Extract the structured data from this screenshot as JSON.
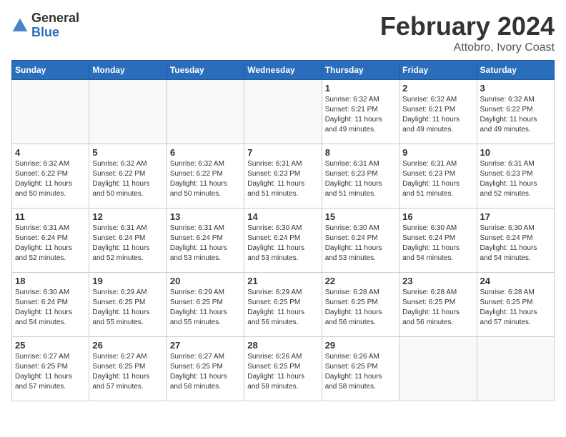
{
  "header": {
    "logo_general": "General",
    "logo_blue": "Blue",
    "month": "February 2024",
    "location": "Attobro, Ivory Coast"
  },
  "weekdays": [
    "Sunday",
    "Monday",
    "Tuesday",
    "Wednesday",
    "Thursday",
    "Friday",
    "Saturday"
  ],
  "weeks": [
    [
      {
        "day": "",
        "detail": ""
      },
      {
        "day": "",
        "detail": ""
      },
      {
        "day": "",
        "detail": ""
      },
      {
        "day": "",
        "detail": ""
      },
      {
        "day": "1",
        "detail": "Sunrise: 6:32 AM\nSunset: 6:21 PM\nDaylight: 11 hours\nand 49 minutes."
      },
      {
        "day": "2",
        "detail": "Sunrise: 6:32 AM\nSunset: 6:21 PM\nDaylight: 11 hours\nand 49 minutes."
      },
      {
        "day": "3",
        "detail": "Sunrise: 6:32 AM\nSunset: 6:22 PM\nDaylight: 11 hours\nand 49 minutes."
      }
    ],
    [
      {
        "day": "4",
        "detail": "Sunrise: 6:32 AM\nSunset: 6:22 PM\nDaylight: 11 hours\nand 50 minutes."
      },
      {
        "day": "5",
        "detail": "Sunrise: 6:32 AM\nSunset: 6:22 PM\nDaylight: 11 hours\nand 50 minutes."
      },
      {
        "day": "6",
        "detail": "Sunrise: 6:32 AM\nSunset: 6:22 PM\nDaylight: 11 hours\nand 50 minutes."
      },
      {
        "day": "7",
        "detail": "Sunrise: 6:31 AM\nSunset: 6:23 PM\nDaylight: 11 hours\nand 51 minutes."
      },
      {
        "day": "8",
        "detail": "Sunrise: 6:31 AM\nSunset: 6:23 PM\nDaylight: 11 hours\nand 51 minutes."
      },
      {
        "day": "9",
        "detail": "Sunrise: 6:31 AM\nSunset: 6:23 PM\nDaylight: 11 hours\nand 51 minutes."
      },
      {
        "day": "10",
        "detail": "Sunrise: 6:31 AM\nSunset: 6:23 PM\nDaylight: 11 hours\nand 52 minutes."
      }
    ],
    [
      {
        "day": "11",
        "detail": "Sunrise: 6:31 AM\nSunset: 6:24 PM\nDaylight: 11 hours\nand 52 minutes."
      },
      {
        "day": "12",
        "detail": "Sunrise: 6:31 AM\nSunset: 6:24 PM\nDaylight: 11 hours\nand 52 minutes."
      },
      {
        "day": "13",
        "detail": "Sunrise: 6:31 AM\nSunset: 6:24 PM\nDaylight: 11 hours\nand 53 minutes."
      },
      {
        "day": "14",
        "detail": "Sunrise: 6:30 AM\nSunset: 6:24 PM\nDaylight: 11 hours\nand 53 minutes."
      },
      {
        "day": "15",
        "detail": "Sunrise: 6:30 AM\nSunset: 6:24 PM\nDaylight: 11 hours\nand 53 minutes."
      },
      {
        "day": "16",
        "detail": "Sunrise: 6:30 AM\nSunset: 6:24 PM\nDaylight: 11 hours\nand 54 minutes."
      },
      {
        "day": "17",
        "detail": "Sunrise: 6:30 AM\nSunset: 6:24 PM\nDaylight: 11 hours\nand 54 minutes."
      }
    ],
    [
      {
        "day": "18",
        "detail": "Sunrise: 6:30 AM\nSunset: 6:24 PM\nDaylight: 11 hours\nand 54 minutes."
      },
      {
        "day": "19",
        "detail": "Sunrise: 6:29 AM\nSunset: 6:25 PM\nDaylight: 11 hours\nand 55 minutes."
      },
      {
        "day": "20",
        "detail": "Sunrise: 6:29 AM\nSunset: 6:25 PM\nDaylight: 11 hours\nand 55 minutes."
      },
      {
        "day": "21",
        "detail": "Sunrise: 6:29 AM\nSunset: 6:25 PM\nDaylight: 11 hours\nand 56 minutes."
      },
      {
        "day": "22",
        "detail": "Sunrise: 6:28 AM\nSunset: 6:25 PM\nDaylight: 11 hours\nand 56 minutes."
      },
      {
        "day": "23",
        "detail": "Sunrise: 6:28 AM\nSunset: 6:25 PM\nDaylight: 11 hours\nand 56 minutes."
      },
      {
        "day": "24",
        "detail": "Sunrise: 6:28 AM\nSunset: 6:25 PM\nDaylight: 11 hours\nand 57 minutes."
      }
    ],
    [
      {
        "day": "25",
        "detail": "Sunrise: 6:27 AM\nSunset: 6:25 PM\nDaylight: 11 hours\nand 57 minutes."
      },
      {
        "day": "26",
        "detail": "Sunrise: 6:27 AM\nSunset: 6:25 PM\nDaylight: 11 hours\nand 57 minutes."
      },
      {
        "day": "27",
        "detail": "Sunrise: 6:27 AM\nSunset: 6:25 PM\nDaylight: 11 hours\nand 58 minutes."
      },
      {
        "day": "28",
        "detail": "Sunrise: 6:26 AM\nSunset: 6:25 PM\nDaylight: 11 hours\nand 58 minutes."
      },
      {
        "day": "29",
        "detail": "Sunrise: 6:26 AM\nSunset: 6:25 PM\nDaylight: 11 hours\nand 58 minutes."
      },
      {
        "day": "",
        "detail": ""
      },
      {
        "day": "",
        "detail": ""
      }
    ]
  ]
}
